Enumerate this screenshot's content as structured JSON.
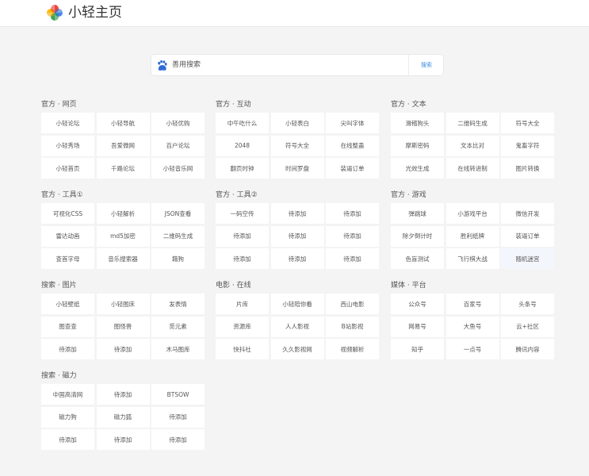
{
  "header": {
    "title": "小轻主页"
  },
  "search": {
    "placeholder": "善用搜索",
    "button_label": "搜索"
  },
  "sections": [
    {
      "title": "官方 · 网页",
      "items": [
        "小轻论坛",
        "小轻导航",
        "小轻优购",
        "小轻秀场",
        "吾爱微网",
        "百户论坛",
        "小轻首页",
        "千路论坛",
        "小轻音乐网"
      ]
    },
    {
      "title": "官方 · 互动",
      "items": [
        "中午吃什么",
        "小轻表白",
        "尖叫字体",
        "2048",
        "符号大全",
        "在线整蛊",
        "翻页时钟",
        "时间罗盘",
        "装逼订单"
      ]
    },
    {
      "title": "官方 · 文本",
      "items": [
        "滑稽狗头",
        "二维码生成",
        "符号大全",
        "摩斯密码",
        "文本比对",
        "鬼畜字符",
        "光效生成",
        "在线转进制",
        "图片转换"
      ]
    },
    {
      "title": "官方 · 工具①",
      "items": [
        "可视化CSS",
        "小轻解析",
        "JSON查看",
        "雷达动画",
        "md5加密",
        "二维码生成",
        "查首字母",
        "音乐搜索器",
        "藉狗"
      ]
    },
    {
      "title": "官方 · 工具②",
      "items": [
        "一码空传",
        "待添加",
        "待添加",
        "待添加",
        "待添加",
        "待添加",
        "待添加",
        "待添加",
        "待添加"
      ]
    },
    {
      "title": "官方 · 游戏",
      "items": [
        "弹跳球",
        "小游戏平台",
        "微信开发",
        "除夕倒计时",
        "胜利纸牌",
        "装逼订单",
        "色盲测试",
        "飞行棋大战",
        "随机迷宫"
      ]
    },
    {
      "title": "搜索 · 图片",
      "items": [
        "小轻壁纸",
        "小轻图床",
        "发表情",
        "图查查",
        "图怪兽",
        "觅元素",
        "待添加",
        "待添加",
        "木马图库"
      ]
    },
    {
      "title": "电影 · 在线",
      "items": [
        "片库",
        "小轻陪你看",
        "西山电影",
        "资源库",
        "人人影视",
        "B站影视",
        "快抖社",
        "久久影视网",
        "视频解析"
      ]
    },
    {
      "title": "媒体 · 平台",
      "items": [
        "公众号",
        "百家号",
        "头条号",
        "网易号",
        "大鱼号",
        "云+社区",
        "知乎",
        "一点号",
        "腾讯内容"
      ]
    },
    {
      "title": "搜索 · 磁力",
      "items": [
        "中国高清网",
        "待添加",
        "BTSOW",
        "磁力狗",
        "磁力狐",
        "待添加",
        "待添加",
        "待添加",
        "待添加"
      ]
    }
  ]
}
